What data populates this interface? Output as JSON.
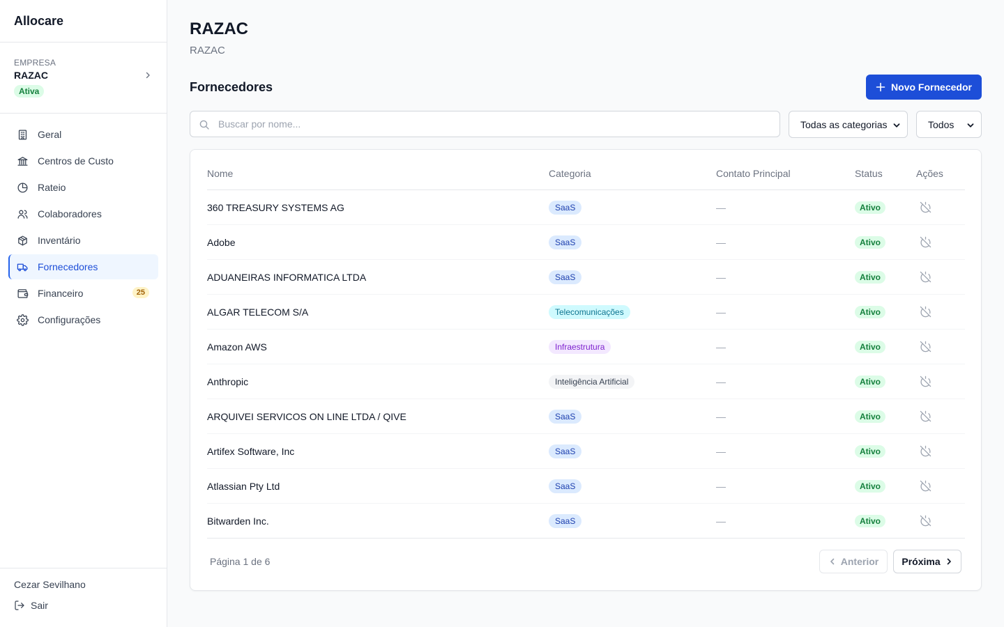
{
  "app": {
    "brand": "Allocare"
  },
  "company": {
    "label": "EMPRESA",
    "name": "RAZAC",
    "status": "Ativa"
  },
  "nav": [
    {
      "label": "Geral",
      "icon": "building-icon"
    },
    {
      "label": "Centros de Custo",
      "icon": "bank-icon"
    },
    {
      "label": "Rateio",
      "icon": "pie-chart-icon"
    },
    {
      "label": "Colaboradores",
      "icon": "users-icon"
    },
    {
      "label": "Inventário",
      "icon": "package-icon"
    },
    {
      "label": "Fornecedores",
      "icon": "truck-icon",
      "active": true
    },
    {
      "label": "Financeiro",
      "icon": "wallet-icon",
      "count": "25"
    },
    {
      "label": "Configurações",
      "icon": "gear-icon"
    }
  ],
  "user": {
    "name": "Cezar Sevilhano",
    "logout_label": "Sair"
  },
  "page": {
    "title": "RAZAC",
    "subtitle": "RAZAC"
  },
  "section": {
    "title": "Fornecedores",
    "new_button": "Novo Fornecedor"
  },
  "filters": {
    "search_placeholder": "Buscar por nome...",
    "category_selected": "Todas as categorias",
    "status_selected": "Todos"
  },
  "table": {
    "columns": [
      "Nome",
      "Categoria",
      "Contato Principal",
      "Status",
      "Ações"
    ],
    "rows": [
      {
        "name": "360 TREASURY SYSTEMS AG",
        "category": "SaaS",
        "contact": "—",
        "status": "Ativo"
      },
      {
        "name": "Adobe",
        "category": "SaaS",
        "contact": "—",
        "status": "Ativo"
      },
      {
        "name": "ADUANEIRAS INFORMATICA LTDA",
        "category": "SaaS",
        "contact": "—",
        "status": "Ativo"
      },
      {
        "name": "ALGAR TELECOM S/A",
        "category": "Telecomunicações",
        "contact": "—",
        "status": "Ativo"
      },
      {
        "name": "Amazon AWS",
        "category": "Infraestrutura",
        "contact": "—",
        "status": "Ativo"
      },
      {
        "name": "Anthropic",
        "category": "Inteligência Artificial",
        "contact": "—",
        "status": "Ativo"
      },
      {
        "name": "ARQUIVEI SERVICOS ON LINE LTDA / QIVE",
        "category": "SaaS",
        "contact": "—",
        "status": "Ativo"
      },
      {
        "name": "Artifex Software, Inc",
        "category": "SaaS",
        "contact": "—",
        "status": "Ativo"
      },
      {
        "name": "Atlassian Pty Ltd",
        "category": "SaaS",
        "contact": "—",
        "status": "Ativo"
      },
      {
        "name": "Bitwarden Inc.",
        "category": "SaaS",
        "contact": "—",
        "status": "Ativo"
      }
    ],
    "action_icon": "power-off-icon"
  },
  "pagination": {
    "info": "Página 1 de 6",
    "prev_label": "Anterior",
    "next_label": "Próxima"
  },
  "colors": {
    "primary": "#1d4ed8",
    "active_nav_bg": "#eff6ff",
    "status_green_bg": "#dcfce7",
    "status_green_text": "#15803d"
  }
}
